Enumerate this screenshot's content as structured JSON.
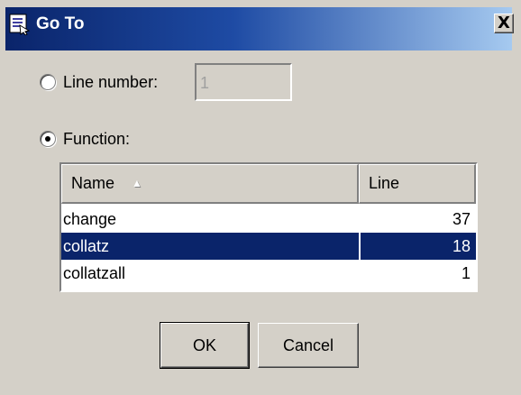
{
  "window": {
    "title": "Go To",
    "close_label": "X"
  },
  "options": {
    "line_number": {
      "label": "Line number:",
      "value": "1",
      "selected": false
    },
    "function": {
      "label": "Function:",
      "selected": true
    }
  },
  "table": {
    "columns": [
      "Name",
      "Line"
    ],
    "sort_column": "Name",
    "rows": [
      {
        "name": "change",
        "line": "37",
        "selected": false
      },
      {
        "name": "collatz",
        "line": "18",
        "selected": true
      },
      {
        "name": "collatzall",
        "line": "1",
        "selected": false
      }
    ]
  },
  "buttons": {
    "ok": "OK",
    "cancel": "Cancel"
  },
  "colors": {
    "title_bar": "#0a246a",
    "selection": "#0a246a",
    "dialog_bg": "#d4d0c8"
  }
}
